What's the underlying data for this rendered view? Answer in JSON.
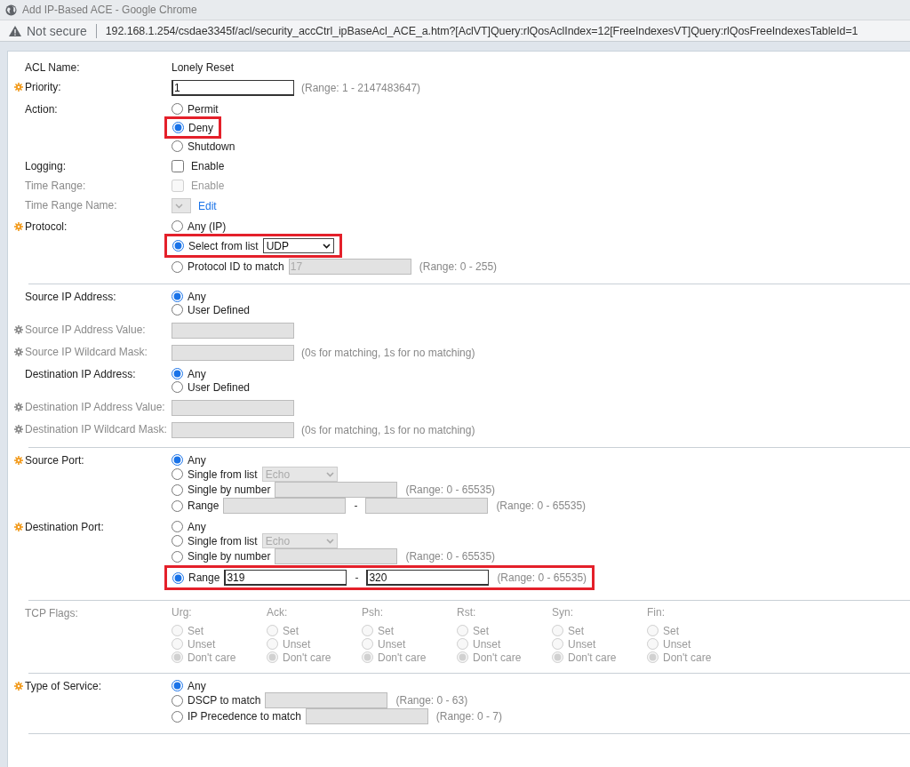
{
  "window": {
    "title": "Add IP-Based ACE - Google Chrome"
  },
  "address_bar": {
    "security": "Not secure",
    "url": "192.168.1.254/csdae3345f/acl/security_accCtrl_ipBaseAcl_ACE_a.htm?[AclVT]Query:rlQosAclIndex=12[FreeIndexesVT]Query:rlQosFreeIndexesTableId=1"
  },
  "sections": [
    {
      "rows": [
        {
          "kind": "text",
          "label": "ACL Name:",
          "required": false,
          "disabled": false,
          "value": "Lonely Reset"
        },
        {
          "kind": "input",
          "label": "Priority:",
          "required": true,
          "disabled": false,
          "value": "1",
          "hint": "(Range: 1 - 2147483647)"
        },
        {
          "kind": "radio",
          "label": "Action:",
          "required": false,
          "disabled": false,
          "options": [
            {
              "label": "Permit",
              "selected": false,
              "highlighted": false
            },
            {
              "label": "Deny",
              "selected": true,
              "highlighted": true
            },
            {
              "label": "Shutdown",
              "selected": false,
              "highlighted": false
            }
          ]
        },
        {
          "kind": "checkbox",
          "label": "Logging:",
          "required": false,
          "disabled": false,
          "option": "Enable",
          "checked": false
        },
        {
          "kind": "checkbox",
          "label": "Time Range:",
          "required": false,
          "disabled": true,
          "option": "Enable",
          "checked": false
        },
        {
          "kind": "select_link",
          "label": "Time Range Name:",
          "required": false,
          "disabled": true,
          "link": "Edit"
        },
        {
          "kind": "radio",
          "label": "Protocol:",
          "required": true,
          "disabled": false,
          "options": [
            {
              "label": "Any (IP)",
              "selected": false,
              "highlighted": false
            },
            {
              "label": "Select from list",
              "selected": true,
              "highlighted": true,
              "fields": [
                {
                  "kind": "select",
                  "value": "UDP",
                  "disabled": false
                }
              ]
            },
            {
              "label": "Protocol ID to match",
              "selected": false,
              "highlighted": false,
              "fields": [
                {
                  "kind": "input",
                  "value": "17",
                  "disabled": true
                }
              ],
              "hint": "(Range: 0 - 255)"
            }
          ]
        }
      ]
    },
    {
      "rows": [
        {
          "kind": "radio",
          "label": "Source IP Address:",
          "required": false,
          "disabled": false,
          "options": [
            {
              "label": "Any",
              "selected": true,
              "highlighted": false
            },
            {
              "label": "User Defined",
              "selected": false,
              "highlighted": false
            }
          ]
        },
        {
          "kind": "input",
          "label": "Source IP Address Value:",
          "required": true,
          "disabled": true
        },
        {
          "kind": "input",
          "label": "Source IP Wildcard Mask:",
          "required": true,
          "disabled": true,
          "hint": "(0s for matching, 1s for no matching)"
        },
        {
          "kind": "radio",
          "label": "Destination IP Address:",
          "required": false,
          "disabled": false,
          "options": [
            {
              "label": "Any",
              "selected": true,
              "highlighted": false
            },
            {
              "label": "User Defined",
              "selected": false,
              "highlighted": false
            }
          ]
        },
        {
          "kind": "input",
          "label": "Destination IP Address Value:",
          "required": true,
          "disabled": true
        },
        {
          "kind": "input",
          "label": "Destination IP Wildcard Mask:",
          "required": true,
          "disabled": true,
          "hint": "(0s for matching, 1s for no matching)"
        }
      ]
    },
    {
      "rows": [
        {
          "kind": "radio",
          "label": "Source Port:",
          "required": true,
          "disabled": false,
          "options": [
            {
              "label": "Any",
              "selected": true,
              "highlighted": false
            },
            {
              "label": "Single from list",
              "selected": false,
              "highlighted": false,
              "fields": [
                {
                  "kind": "select",
                  "value": "Echo",
                  "disabled": true
                }
              ]
            },
            {
              "label": "Single by number",
              "selected": false,
              "highlighted": false,
              "fields": [
                {
                  "kind": "input",
                  "disabled": true
                }
              ],
              "hint": "(Range: 0 - 65535)"
            },
            {
              "label": "Range",
              "selected": false,
              "highlighted": false,
              "fields": [
                {
                  "kind": "input",
                  "disabled": true
                },
                {
                  "kind": "dash",
                  "value": "-"
                },
                {
                  "kind": "input",
                  "disabled": true
                }
              ],
              "hint": "(Range: 0 - 65535)"
            }
          ]
        },
        {
          "kind": "radio",
          "label": "Destination Port:",
          "required": true,
          "disabled": false,
          "options": [
            {
              "label": "Any",
              "selected": false,
              "highlighted": false
            },
            {
              "label": "Single from list",
              "selected": false,
              "highlighted": false,
              "fields": [
                {
                  "kind": "select",
                  "value": "Echo",
                  "disabled": true
                }
              ]
            },
            {
              "label": "Single by number",
              "selected": false,
              "highlighted": false,
              "fields": [
                {
                  "kind": "input",
                  "disabled": true
                }
              ],
              "hint": "(Range: 0 - 65535)"
            },
            {
              "label": "Range",
              "selected": true,
              "highlighted": true,
              "fields": [
                {
                  "kind": "input",
                  "value": "319",
                  "disabled": false
                },
                {
                  "kind": "dash",
                  "value": "-"
                },
                {
                  "kind": "input",
                  "value": "320",
                  "disabled": false
                }
              ],
              "hint": "(Range: 0 - 65535)"
            }
          ]
        }
      ]
    },
    {
      "rows": [
        {
          "kind": "flags",
          "label": "TCP Flags:",
          "required": false,
          "disabled": true,
          "flags": [
            {
              "name": "Urg:",
              "options": [
                {
                  "label": "Set",
                  "selected": false
                },
                {
                  "label": "Unset",
                  "selected": false
                },
                {
                  "label": "Don't care",
                  "selected": true
                }
              ]
            },
            {
              "name": "Ack:",
              "options": [
                {
                  "label": "Set",
                  "selected": false
                },
                {
                  "label": "Unset",
                  "selected": false
                },
                {
                  "label": "Don't care",
                  "selected": true
                }
              ]
            },
            {
              "name": "Psh:",
              "options": [
                {
                  "label": "Set",
                  "selected": false
                },
                {
                  "label": "Unset",
                  "selected": false
                },
                {
                  "label": "Don't care",
                  "selected": true
                }
              ]
            },
            {
              "name": "Rst:",
              "options": [
                {
                  "label": "Set",
                  "selected": false
                },
                {
                  "label": "Unset",
                  "selected": false
                },
                {
                  "label": "Don't care",
                  "selected": true
                }
              ]
            },
            {
              "name": "Syn:",
              "options": [
                {
                  "label": "Set",
                  "selected": false
                },
                {
                  "label": "Unset",
                  "selected": false
                },
                {
                  "label": "Don't care",
                  "selected": true
                }
              ]
            },
            {
              "name": "Fin:",
              "options": [
                {
                  "label": "Set",
                  "selected": false
                },
                {
                  "label": "Unset",
                  "selected": false
                },
                {
                  "label": "Don't care",
                  "selected": true
                }
              ]
            }
          ]
        }
      ]
    },
    {
      "rows": [
        {
          "kind": "radio",
          "label": "Type of Service:",
          "required": true,
          "disabled": false,
          "options": [
            {
              "label": "Any",
              "selected": true,
              "highlighted": false
            },
            {
              "label": "DSCP to match",
              "selected": false,
              "highlighted": false,
              "fields": [
                {
                  "kind": "input",
                  "disabled": true
                }
              ],
              "hint": "(Range: 0 - 63)"
            },
            {
              "label": "IP Precedence to match",
              "selected": false,
              "highlighted": false,
              "fields": [
                {
                  "kind": "input",
                  "disabled": true
                }
              ],
              "hint": "(Range: 0 - 7)"
            }
          ]
        }
      ]
    }
  ]
}
